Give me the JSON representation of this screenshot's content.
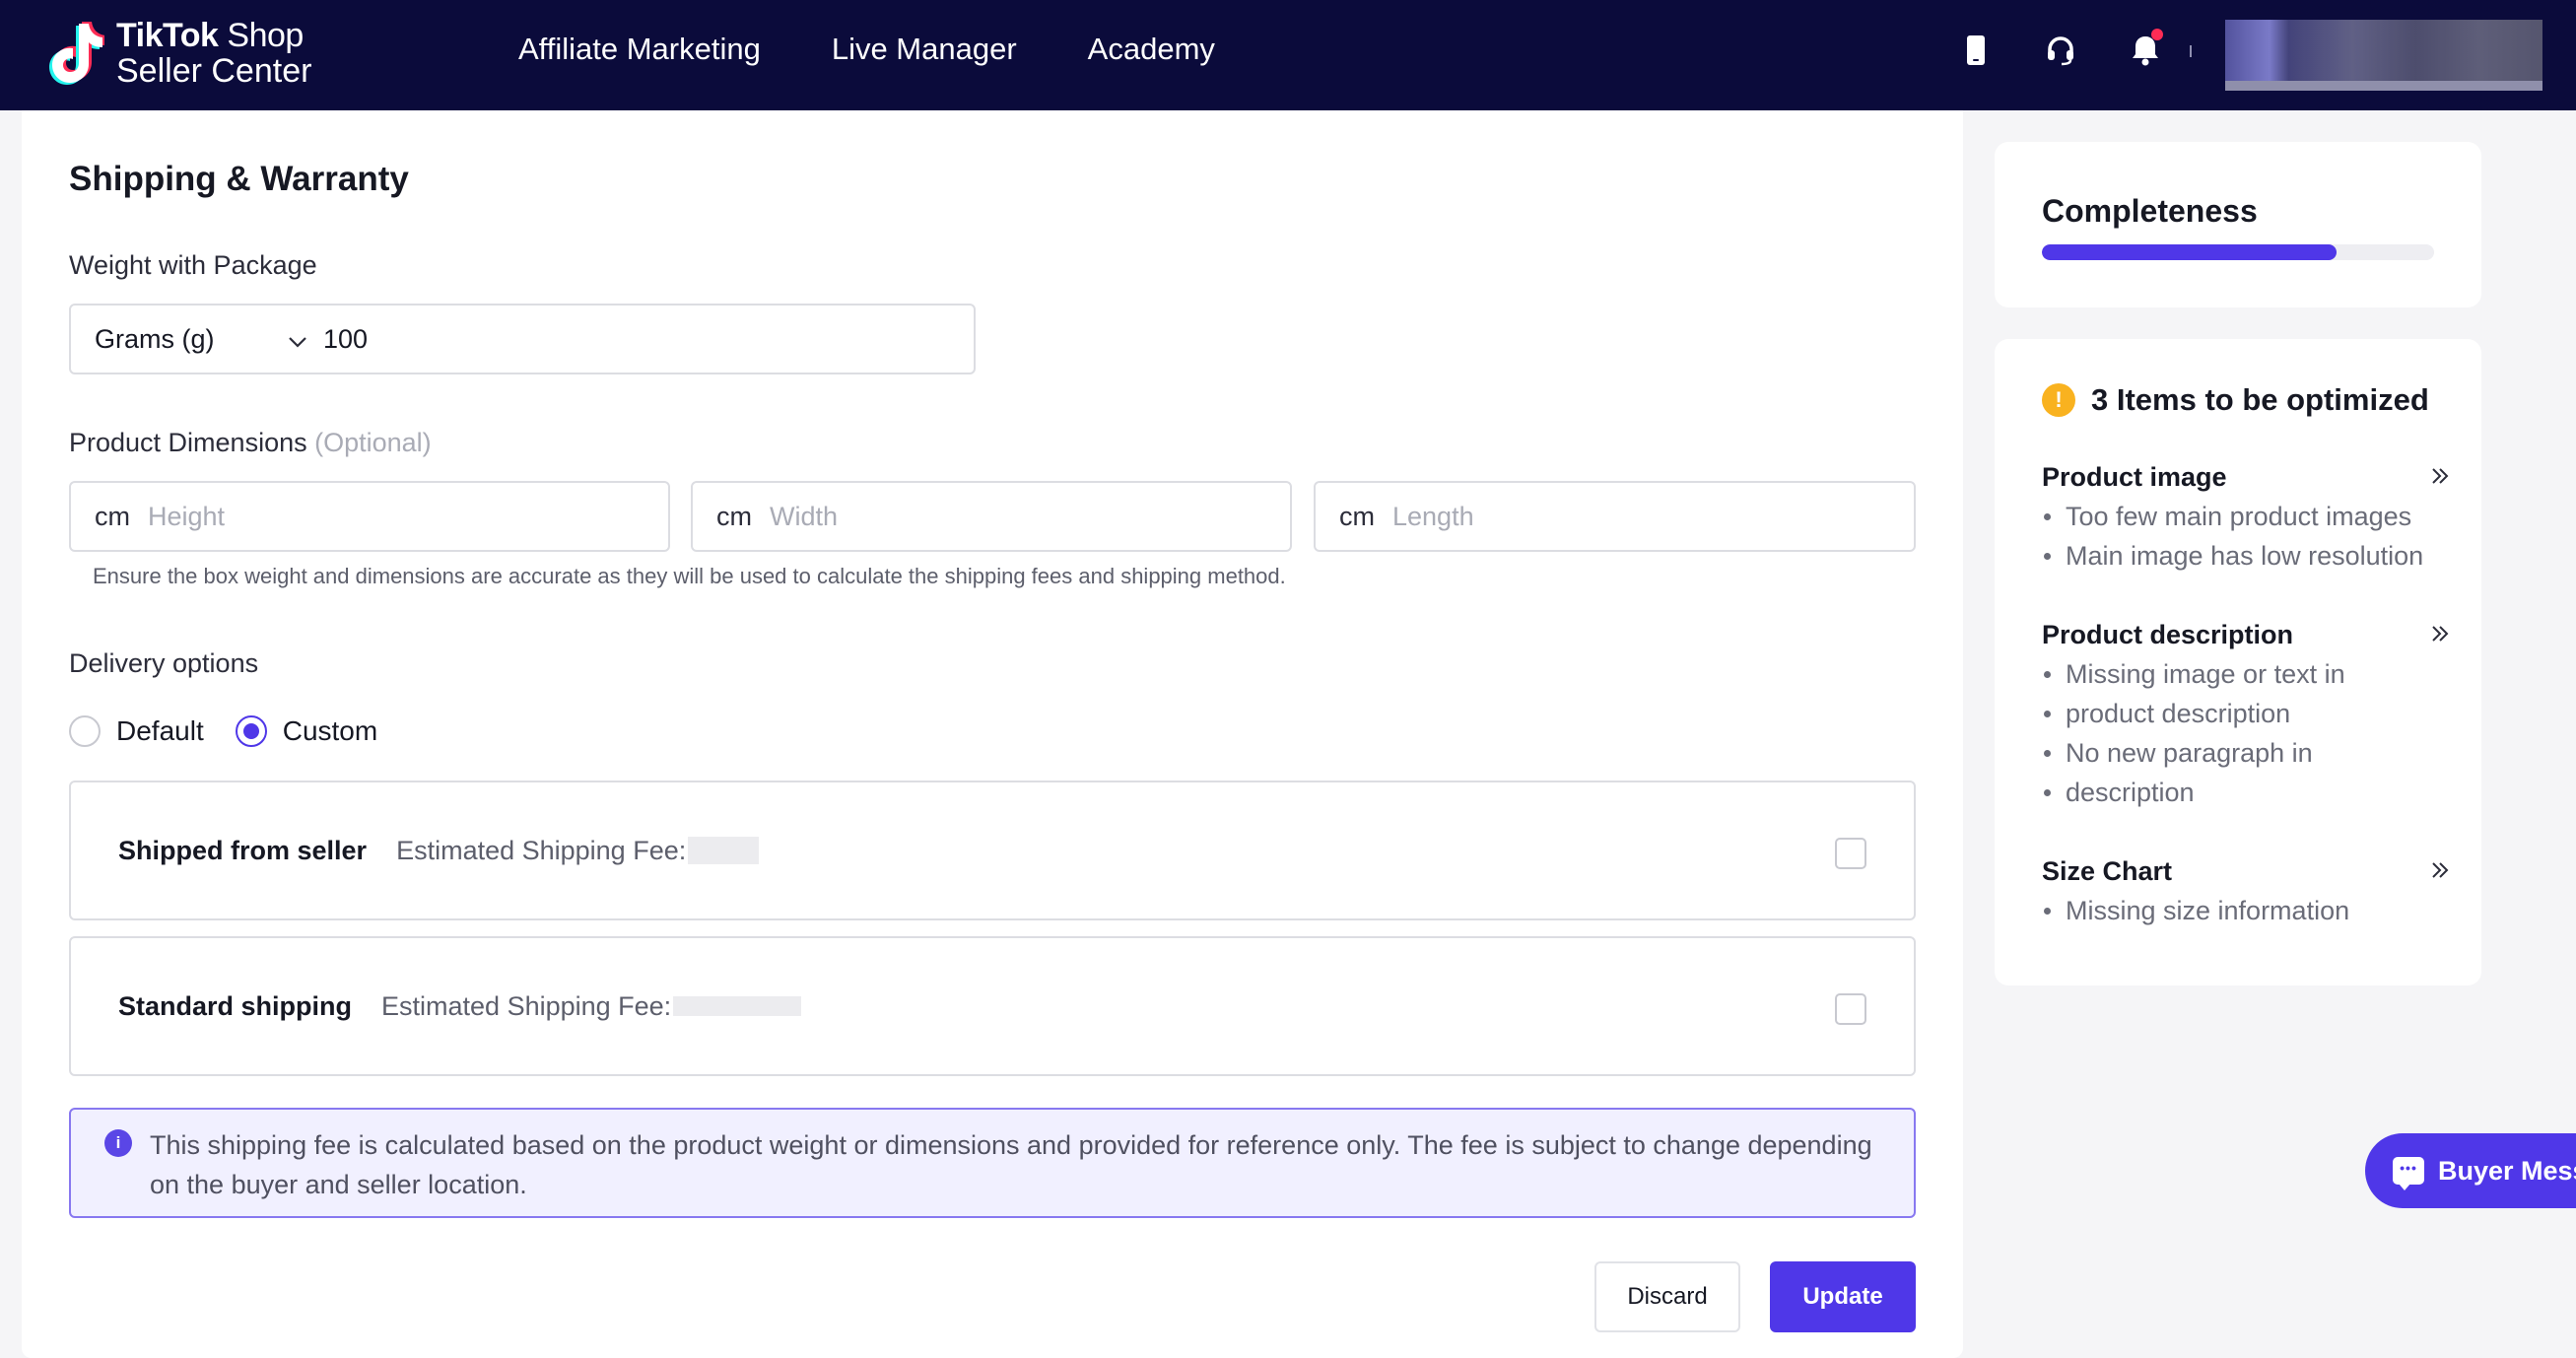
{
  "header": {
    "logo_brand": "TikTok",
    "logo_shop": "Shop",
    "logo_subtitle": "Seller Center",
    "nav": [
      {
        "label": "Affiliate Marketing"
      },
      {
        "label": "Live Manager"
      },
      {
        "label": "Academy"
      }
    ],
    "icons": [
      "phone-icon",
      "headset-icon",
      "bell-icon"
    ]
  },
  "form": {
    "section_title": "Shipping & Warranty",
    "weight": {
      "label": "Weight with Package",
      "unit": "Grams (g)",
      "value": "100"
    },
    "dimensions": {
      "label": "Product Dimensions",
      "optional": "(Optional)",
      "fields": [
        {
          "unit": "cm",
          "placeholder": "Height"
        },
        {
          "unit": "cm",
          "placeholder": "Width"
        },
        {
          "unit": "cm",
          "placeholder": "Length"
        }
      ],
      "hint": "Ensure the box weight and dimensions are accurate as they will be used to calculate the shipping fees and shipping method."
    },
    "delivery": {
      "label": "Delivery options",
      "options": [
        "Default",
        "Custom"
      ],
      "selected": "Custom",
      "methods": [
        {
          "name": "Shipped from seller",
          "fee_label": "Estimated Shipping Fee:"
        },
        {
          "name": "Standard shipping",
          "fee_label": "Estimated Shipping Fee:"
        }
      ],
      "info": "This shipping fee is calculated based on the product weight or dimensions and provided for reference only. The fee is subject to change depending on the buyer and seller location."
    },
    "buttons": {
      "discard": "Discard",
      "update": "Update"
    }
  },
  "completeness": {
    "title": "Completeness",
    "progress_fraction": 0.75
  },
  "optimization": {
    "title": "3 Items to be optimized",
    "groups": [
      {
        "title": "Product image",
        "items": [
          "Too few main product images",
          "Main image has low resolution"
        ]
      },
      {
        "title": "Product description",
        "items": [
          "Missing image or text in",
          "product description",
          "No new paragraph in",
          "description"
        ]
      },
      {
        "title": "Size Chart",
        "items": [
          "Missing size information"
        ]
      }
    ]
  },
  "floating": {
    "buyer_message": "Buyer Mess"
  },
  "colors": {
    "header_bg": "#0b0b3b",
    "accent": "#4f37e8",
    "warning": "#f9b21f",
    "notification": "#fe2c55"
  }
}
